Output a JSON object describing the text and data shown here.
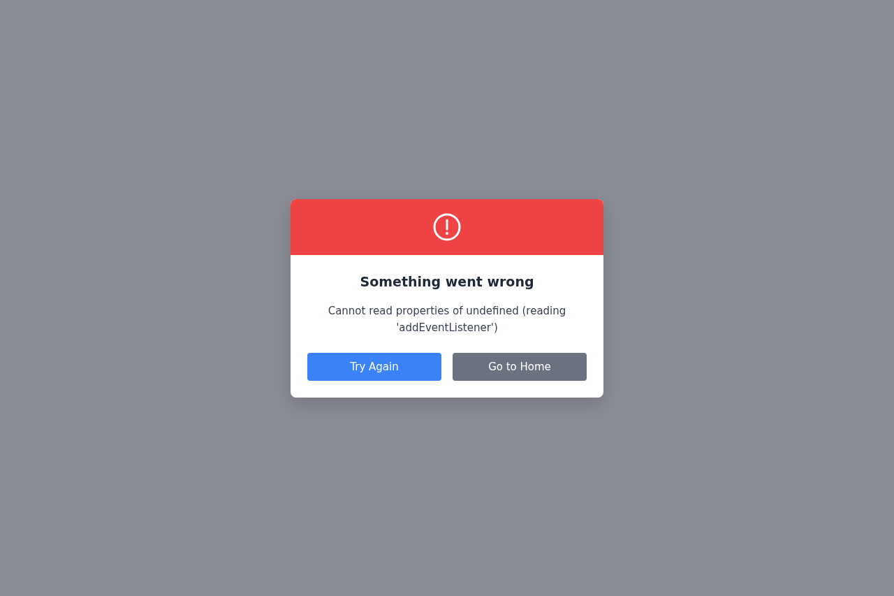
{
  "dialog": {
    "title": "Something went wrong",
    "message": "Cannot read properties of undefined (reading 'addEventListener')",
    "buttons": [
      {
        "label": "Try Again",
        "kind": "primary"
      },
      {
        "label": "Go to Home",
        "kind": "secondary"
      }
    ]
  }
}
